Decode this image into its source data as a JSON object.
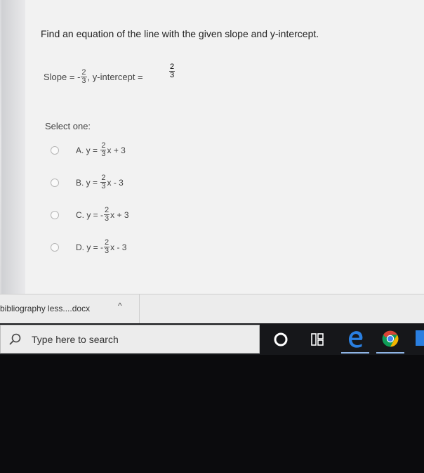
{
  "question": {
    "title": "Find an equation of the line with the given slope and y-intercept.",
    "slope_label": "Slope = -",
    "slope_num": "2",
    "slope_den": "3",
    "yint_label": ", y-intercept =",
    "yint_num": "2",
    "yint_den": "3"
  },
  "select_label": "Select one:",
  "options": [
    {
      "prefix": "A. y = ",
      "num": "2",
      "den": "3",
      "suffix": "x + 3"
    },
    {
      "prefix": "B. y = ",
      "num": "2",
      "den": "3",
      "suffix": "x - 3"
    },
    {
      "prefix": "C. y = -",
      "num": "2",
      "den": "3",
      "suffix": "x + 3"
    },
    {
      "prefix": "D. y = -",
      "num": "2",
      "den": "3",
      "suffix": "x - 3"
    }
  ],
  "download": {
    "filename": "bibliography less....docx",
    "chevron": "^"
  },
  "taskbar": {
    "search_placeholder": "Type here to search"
  },
  "colors": {
    "edge_blue": "#1f6fd1",
    "chrome_red": "#db4437",
    "chrome_yellow": "#f4b400",
    "chrome_green": "#0f9d58"
  }
}
